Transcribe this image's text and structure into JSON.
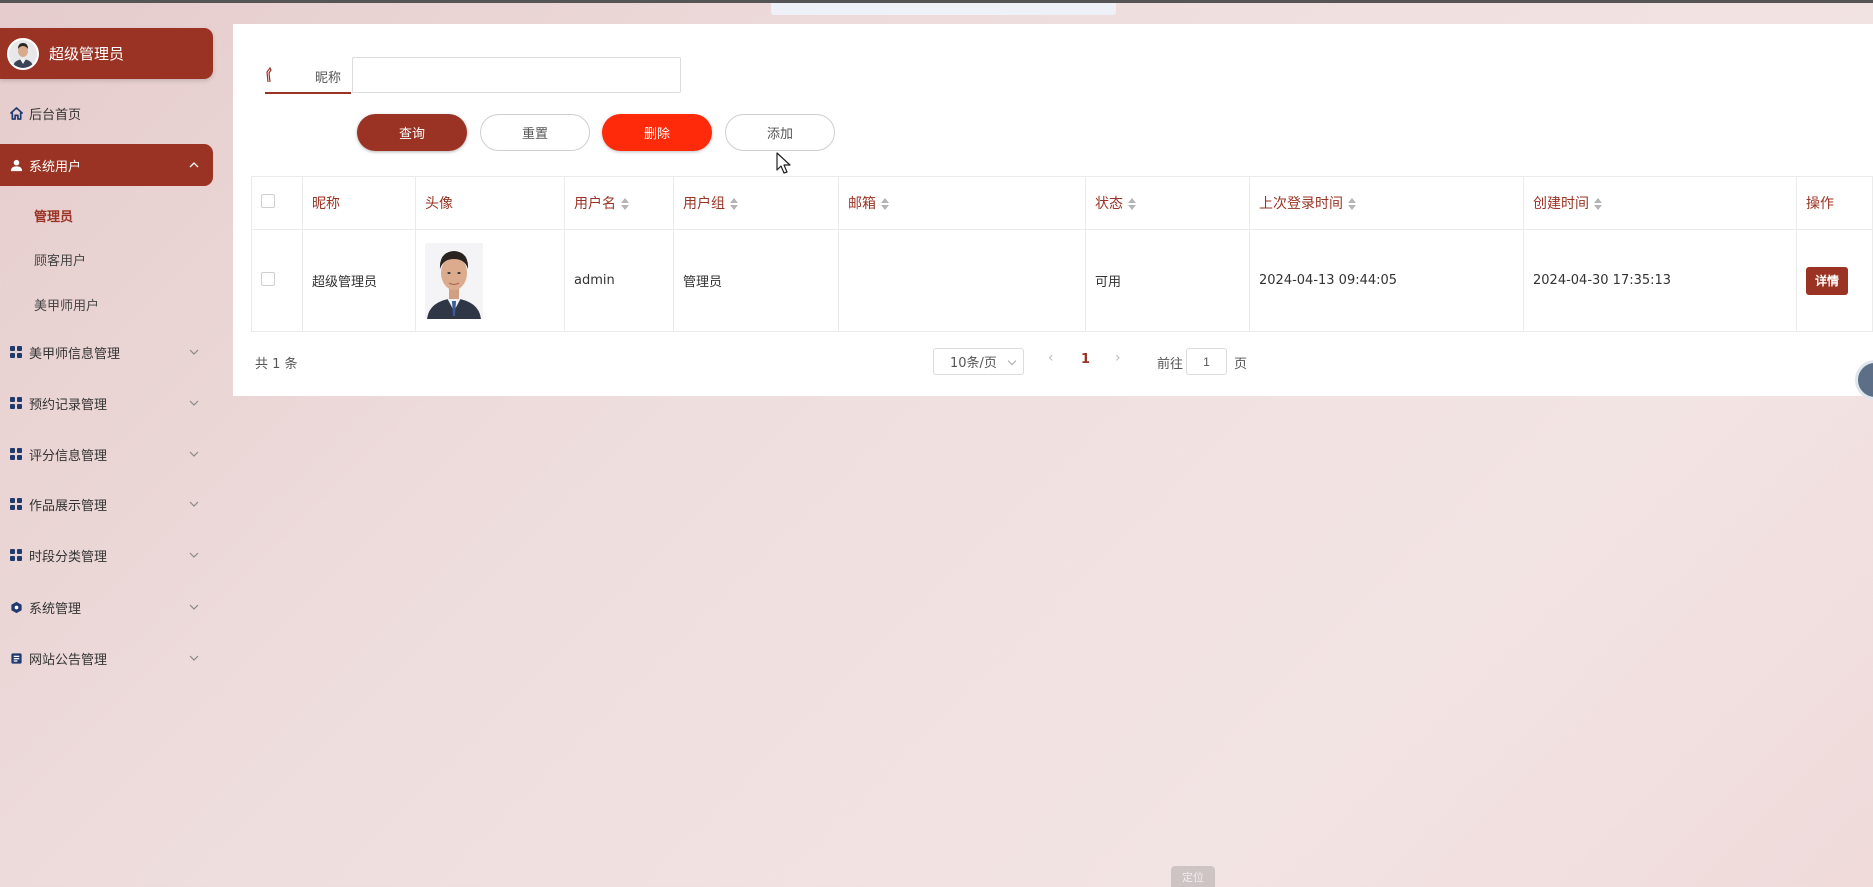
{
  "user": {
    "name": "超级管理员"
  },
  "sidebar": {
    "items": [
      {
        "label": "后台首页",
        "icon": "home-icon"
      },
      {
        "label": "系统用户",
        "icon": "user-icon",
        "active": true
      },
      {
        "label": "美甲师信息管理",
        "icon": "grid-icon"
      },
      {
        "label": "预约记录管理",
        "icon": "grid-icon"
      },
      {
        "label": "评分信息管理",
        "icon": "grid-icon"
      },
      {
        "label": "作品展示管理",
        "icon": "grid-icon"
      },
      {
        "label": "时段分类管理",
        "icon": "grid-icon"
      },
      {
        "label": "系统管理",
        "icon": "settings-hex-icon"
      },
      {
        "label": "网站公告管理",
        "icon": "notice-icon"
      }
    ],
    "submenu": [
      {
        "label": "管理员",
        "current": true
      },
      {
        "label": "顾客用户"
      },
      {
        "label": "美甲师用户"
      }
    ]
  },
  "search": {
    "label": "昵称",
    "value": ""
  },
  "buttons": {
    "query": "查询",
    "reset": "重置",
    "delete": "删除",
    "add": "添加"
  },
  "table": {
    "headers": [
      "昵称",
      "头像",
      "用户名",
      "用户组",
      "邮箱",
      "状态",
      "上次登录时间",
      "创建时间",
      "操作"
    ],
    "rows": [
      {
        "nickname": "超级管理员",
        "username": "admin",
        "group": "管理员",
        "email": "",
        "status": "可用",
        "last_login": "2024-04-13 09:44:05",
        "created": "2024-04-30 17:35:13",
        "action": "详情"
      }
    ]
  },
  "pagination": {
    "total": "共 1 条",
    "page_size": "10条/页",
    "current_page": "1",
    "goto_label": "前往",
    "goto_value": "1",
    "goto_unit": "页"
  },
  "bottom_chip": "定位",
  "colors": {
    "primary": "#9a3324",
    "danger": "#ff2a0a",
    "icon": "#1f3a6e"
  }
}
